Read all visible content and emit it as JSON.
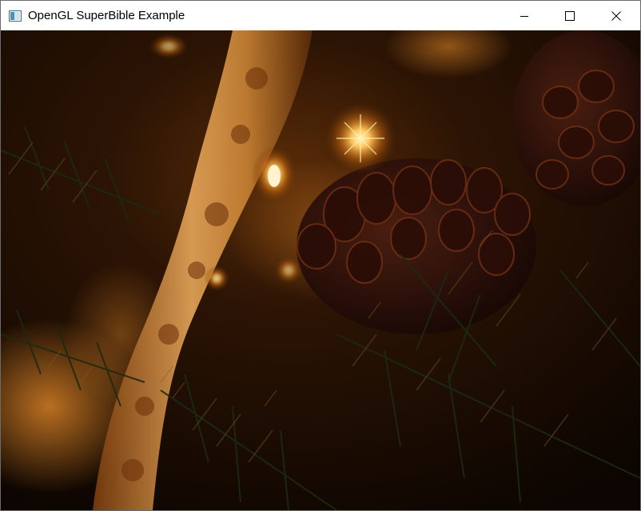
{
  "window": {
    "title": "OpenGL SuperBible Example",
    "app_icon": "opengl-window-icon"
  },
  "caption_buttons": {
    "minimize_icon": "minimize-icon",
    "maximize_icon": "maximize-icon",
    "close_icon": "close-icon"
  },
  "render": {
    "content_icon": "rendered-hdr-texture-image",
    "dominant_colors": [
      "#120802",
      "#3a1a06",
      "#c0751e",
      "#ffd47a"
    ]
  }
}
